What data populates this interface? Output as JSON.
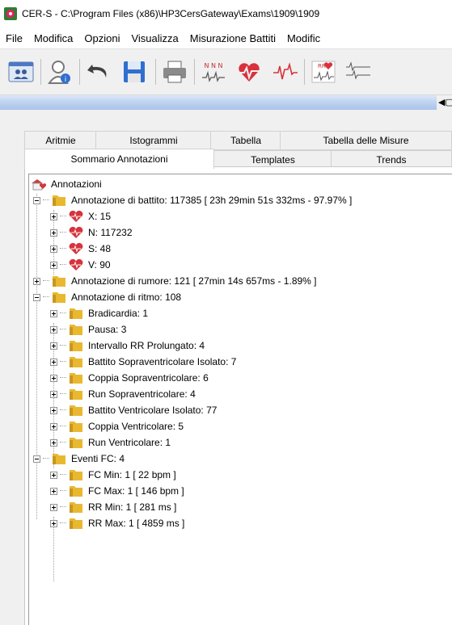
{
  "window": {
    "title": "CER-S - C:\\Program Files (x86)\\HP3CersGateway\\Exams\\1909\\1909"
  },
  "menu": [
    "File",
    "Modifica",
    "Opzioni",
    "Visualizza",
    "Misurazione Battiti",
    "Modific"
  ],
  "toolbar": {
    "icons": [
      "patients-icon",
      "user-info-icon",
      "undo-icon",
      "save-icon",
      "print-icon",
      "nnn-beats-icon",
      "heart-ecg-icon",
      "ecg-wave-icon",
      "rr-heart-grid-icon",
      "ecg-traces-icon"
    ]
  },
  "strip_button": "◀▢",
  "tabs": {
    "row1": [
      "Aritmie",
      "Istogrammi",
      "Tabella",
      "Tabella delle Misure"
    ],
    "row2": [
      "Sommario Annotazioni",
      "Templates",
      "Trends"
    ],
    "active": "Sommario Annotazioni"
  },
  "tree": {
    "root": "Annotazioni",
    "beat": {
      "label": "Annotazione di battito: 117385 [ 23h 29min 51s 332ms - 97.97% ]",
      "children": [
        "X: 15",
        "N: 117232",
        "S: 48",
        "V: 90"
      ]
    },
    "noise": "Annotazione di rumore: 121 [ 27min 14s 657ms - 1.89% ]",
    "rhythm": {
      "label": "Annotazione di ritmo: 108",
      "children": [
        "Bradicardia: 1",
        "Pausa: 3",
        "Intervallo RR Prolungato: 4",
        "Battito Sopraventricolare Isolato: 7",
        "Coppia Sopraventricolare: 6",
        "Run Sopraventricolare: 4",
        "Battito Ventricolare Isolato: 77",
        "Coppia Ventricolare: 5",
        "Run Ventricolare: 1"
      ]
    },
    "hr_events": {
      "label": "Eventi FC: 4",
      "children": [
        "FC Min: 1 [ 22 bpm ]",
        "FC Max: 1 [ 146 bpm ]",
        "RR Min: 1 [ 281 ms ]",
        "RR Max: 1 [ 4859 ms ]"
      ]
    }
  },
  "colors": {
    "folder": "#e8b830",
    "heart": "#d8323c",
    "tab_border": "#d2d2d2",
    "strip": "#b9cfee"
  }
}
